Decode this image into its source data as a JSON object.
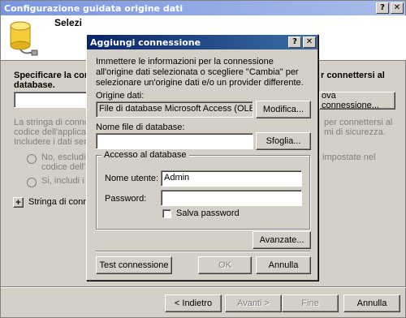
{
  "wizard": {
    "title": "Configurazione guidata origine dati",
    "header_title": "Selezi... connessione dati",
    "header_visible": "Selezi",
    "specify_label": "Specificare la conn",
    "specify_label2": "database.",
    "right_label": "r connettersi al",
    "new_conn_button": "ova connessione...",
    "desc_lines": [
      "La stringa di connes",
      "codice dell'applicazione. L'archiviaz",
      "Includere i dati sensib"
    ],
    "desc_right": [
      "per connettersi al",
      "mi di sicurezza."
    ],
    "radio_no": "No, escludi i c",
    "radio_no2": "codice dell'ap",
    "radio_no_right": "impostate nel",
    "radio_yes": "Si, includi i da",
    "expander_label": "Stringa di conness",
    "buttons": {
      "back": "< Indietro",
      "next": "Avanti >",
      "finish": "Fine",
      "cancel": "Annulla"
    }
  },
  "dialog": {
    "title": "Aggiungi connessione",
    "intro": "Immettere le informazioni per la connessione all'origine dati selezionata o scegliere \"Cambia\" per selezionare un'origine dati e/o un provider differente.",
    "source_label": "Origine dati:",
    "source_value": "File di database Microsoft Access (OLE DB)",
    "modify_button": "Modifica...",
    "file_label": "Nome file di database:",
    "file_value": "",
    "browse_button": "Sfoglia...",
    "group_title": "Accesso al database",
    "user_label": "Nome utente:",
    "user_value": "Admin",
    "password_label": "Password:",
    "password_value": "",
    "save_password_label": "Salva password",
    "advanced_button": "Avanzate...",
    "test_button": "Test connessione",
    "ok_button": "OK",
    "cancel_button": "Annulla"
  },
  "colors": {
    "dialog_title_bg": "#0a246a",
    "outer_title_bg": "#7a96df",
    "face": "#d4d0c8"
  }
}
